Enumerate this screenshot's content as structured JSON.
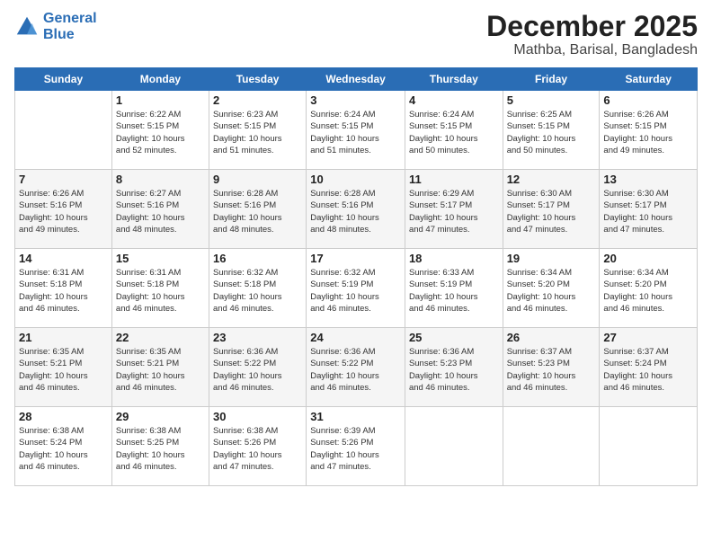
{
  "header": {
    "logo_line1": "General",
    "logo_line2": "Blue",
    "month": "December 2025",
    "location": "Mathba, Barisal, Bangladesh"
  },
  "weekdays": [
    "Sunday",
    "Monday",
    "Tuesday",
    "Wednesday",
    "Thursday",
    "Friday",
    "Saturday"
  ],
  "weeks": [
    [
      {
        "day": "",
        "info": ""
      },
      {
        "day": "1",
        "info": "Sunrise: 6:22 AM\nSunset: 5:15 PM\nDaylight: 10 hours\nand 52 minutes."
      },
      {
        "day": "2",
        "info": "Sunrise: 6:23 AM\nSunset: 5:15 PM\nDaylight: 10 hours\nand 51 minutes."
      },
      {
        "day": "3",
        "info": "Sunrise: 6:24 AM\nSunset: 5:15 PM\nDaylight: 10 hours\nand 51 minutes."
      },
      {
        "day": "4",
        "info": "Sunrise: 6:24 AM\nSunset: 5:15 PM\nDaylight: 10 hours\nand 50 minutes."
      },
      {
        "day": "5",
        "info": "Sunrise: 6:25 AM\nSunset: 5:15 PM\nDaylight: 10 hours\nand 50 minutes."
      },
      {
        "day": "6",
        "info": "Sunrise: 6:26 AM\nSunset: 5:15 PM\nDaylight: 10 hours\nand 49 minutes."
      }
    ],
    [
      {
        "day": "7",
        "info": "Sunrise: 6:26 AM\nSunset: 5:16 PM\nDaylight: 10 hours\nand 49 minutes."
      },
      {
        "day": "8",
        "info": "Sunrise: 6:27 AM\nSunset: 5:16 PM\nDaylight: 10 hours\nand 48 minutes."
      },
      {
        "day": "9",
        "info": "Sunrise: 6:28 AM\nSunset: 5:16 PM\nDaylight: 10 hours\nand 48 minutes."
      },
      {
        "day": "10",
        "info": "Sunrise: 6:28 AM\nSunset: 5:16 PM\nDaylight: 10 hours\nand 48 minutes."
      },
      {
        "day": "11",
        "info": "Sunrise: 6:29 AM\nSunset: 5:17 PM\nDaylight: 10 hours\nand 47 minutes."
      },
      {
        "day": "12",
        "info": "Sunrise: 6:30 AM\nSunset: 5:17 PM\nDaylight: 10 hours\nand 47 minutes."
      },
      {
        "day": "13",
        "info": "Sunrise: 6:30 AM\nSunset: 5:17 PM\nDaylight: 10 hours\nand 47 minutes."
      }
    ],
    [
      {
        "day": "14",
        "info": "Sunrise: 6:31 AM\nSunset: 5:18 PM\nDaylight: 10 hours\nand 46 minutes."
      },
      {
        "day": "15",
        "info": "Sunrise: 6:31 AM\nSunset: 5:18 PM\nDaylight: 10 hours\nand 46 minutes."
      },
      {
        "day": "16",
        "info": "Sunrise: 6:32 AM\nSunset: 5:18 PM\nDaylight: 10 hours\nand 46 minutes."
      },
      {
        "day": "17",
        "info": "Sunrise: 6:32 AM\nSunset: 5:19 PM\nDaylight: 10 hours\nand 46 minutes."
      },
      {
        "day": "18",
        "info": "Sunrise: 6:33 AM\nSunset: 5:19 PM\nDaylight: 10 hours\nand 46 minutes."
      },
      {
        "day": "19",
        "info": "Sunrise: 6:34 AM\nSunset: 5:20 PM\nDaylight: 10 hours\nand 46 minutes."
      },
      {
        "day": "20",
        "info": "Sunrise: 6:34 AM\nSunset: 5:20 PM\nDaylight: 10 hours\nand 46 minutes."
      }
    ],
    [
      {
        "day": "21",
        "info": "Sunrise: 6:35 AM\nSunset: 5:21 PM\nDaylight: 10 hours\nand 46 minutes."
      },
      {
        "day": "22",
        "info": "Sunrise: 6:35 AM\nSunset: 5:21 PM\nDaylight: 10 hours\nand 46 minutes."
      },
      {
        "day": "23",
        "info": "Sunrise: 6:36 AM\nSunset: 5:22 PM\nDaylight: 10 hours\nand 46 minutes."
      },
      {
        "day": "24",
        "info": "Sunrise: 6:36 AM\nSunset: 5:22 PM\nDaylight: 10 hours\nand 46 minutes."
      },
      {
        "day": "25",
        "info": "Sunrise: 6:36 AM\nSunset: 5:23 PM\nDaylight: 10 hours\nand 46 minutes."
      },
      {
        "day": "26",
        "info": "Sunrise: 6:37 AM\nSunset: 5:23 PM\nDaylight: 10 hours\nand 46 minutes."
      },
      {
        "day": "27",
        "info": "Sunrise: 6:37 AM\nSunset: 5:24 PM\nDaylight: 10 hours\nand 46 minutes."
      }
    ],
    [
      {
        "day": "28",
        "info": "Sunrise: 6:38 AM\nSunset: 5:24 PM\nDaylight: 10 hours\nand 46 minutes."
      },
      {
        "day": "29",
        "info": "Sunrise: 6:38 AM\nSunset: 5:25 PM\nDaylight: 10 hours\nand 46 minutes."
      },
      {
        "day": "30",
        "info": "Sunrise: 6:38 AM\nSunset: 5:26 PM\nDaylight: 10 hours\nand 47 minutes."
      },
      {
        "day": "31",
        "info": "Sunrise: 6:39 AM\nSunset: 5:26 PM\nDaylight: 10 hours\nand 47 minutes."
      },
      {
        "day": "",
        "info": ""
      },
      {
        "day": "",
        "info": ""
      },
      {
        "day": "",
        "info": ""
      }
    ]
  ]
}
